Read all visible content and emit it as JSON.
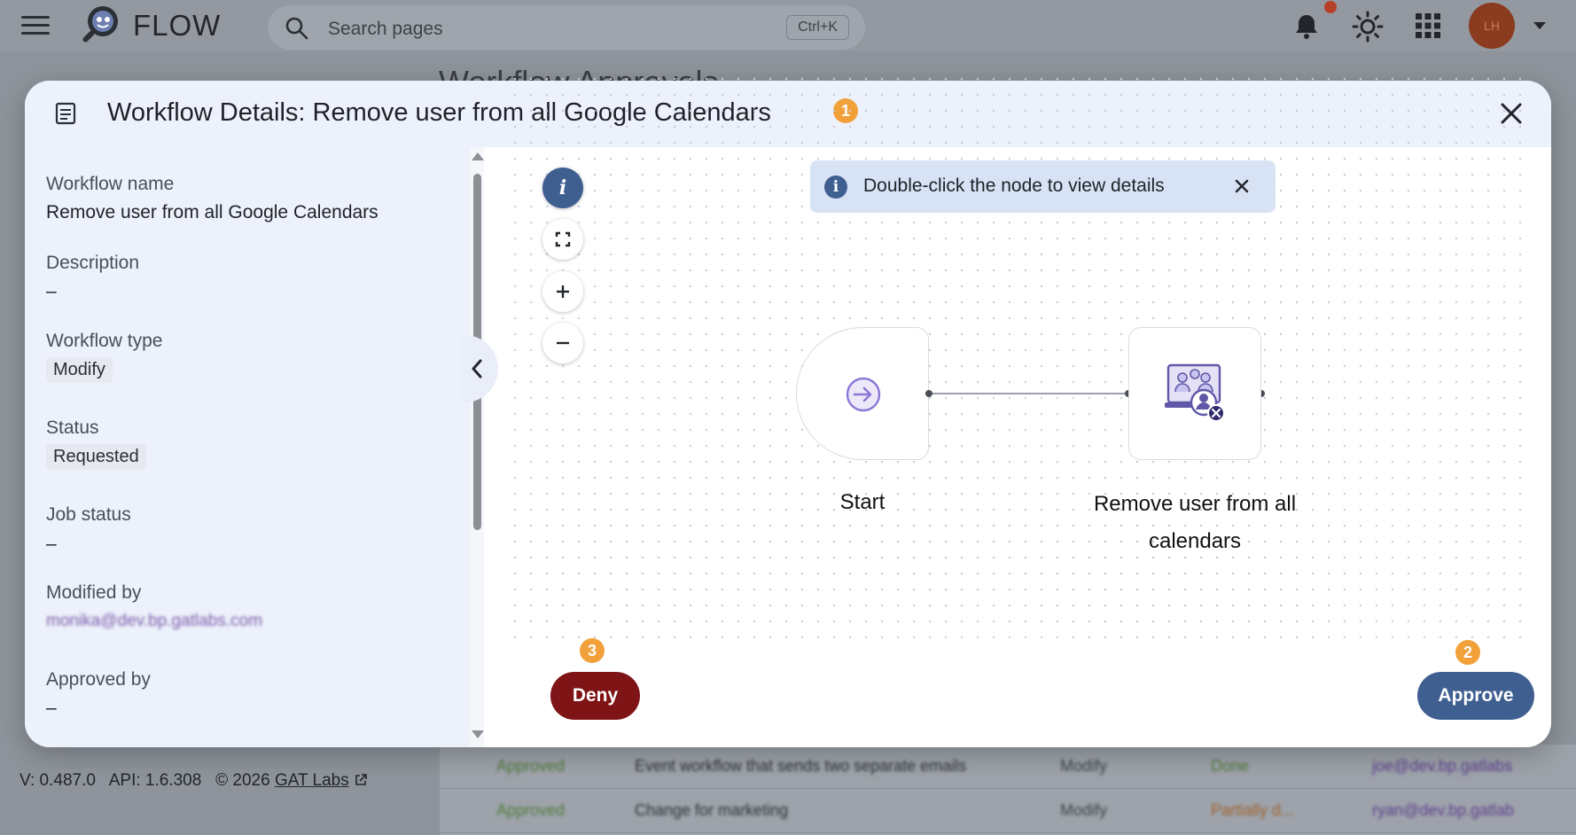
{
  "app": {
    "brand": "FLOW",
    "search_placeholder": "Search pages",
    "search_shortcut": "Ctrl+K",
    "avatar_initials": "LH",
    "background_heading": "Workflow Approvals"
  },
  "modal": {
    "title": "Workflow Details: Remove user from all Google Calendars",
    "title_badge": "1",
    "fields": {
      "workflow_name_label": "Workflow name",
      "workflow_name_value": "Remove user from all Google Calendars",
      "description_label": "Description",
      "description_value": "–",
      "workflow_type_label": "Workflow type",
      "workflow_type_value": "Modify",
      "status_label": "Status",
      "status_value": "Requested",
      "job_status_label": "Job status",
      "job_status_value": "–",
      "modified_by_label": "Modified by",
      "modified_by_value": "monika@dev.bp.gatlabs.com",
      "approved_by_label": "Approved by",
      "approved_by_value": "–"
    },
    "canvas": {
      "toast_text": "Double-click the node to view details",
      "info_glyph": "i",
      "start_node_label": "Start",
      "action_node_label_line1": "Remove user from all",
      "action_node_label_line2": "calendars"
    },
    "actions": {
      "deny_label": "Deny",
      "deny_badge": "3",
      "approve_label": "Approve",
      "approve_badge": "2"
    }
  },
  "background_table": {
    "rows": [
      {
        "status": "Approved",
        "name": "Event workflow that sends two separate emails",
        "type": "Modify",
        "job_status": "Done",
        "modified_by": "joe@dev.bp.gatlabs"
      },
      {
        "status": "Approved",
        "name": "Change for marketing",
        "type": "Modify",
        "job_status": "Partially d...",
        "modified_by": "ryan@dev.bp.gatlab"
      }
    ]
  },
  "footer": {
    "version": "V: 0.487.0",
    "api": "API: 1.6.308",
    "copyright": "© 2026",
    "company_link": "GAT Labs"
  },
  "colors": {
    "primary": "#3f5f91",
    "deny": "#7f1416",
    "badge": "#f2a03a",
    "panel": "#ecf1fb"
  }
}
